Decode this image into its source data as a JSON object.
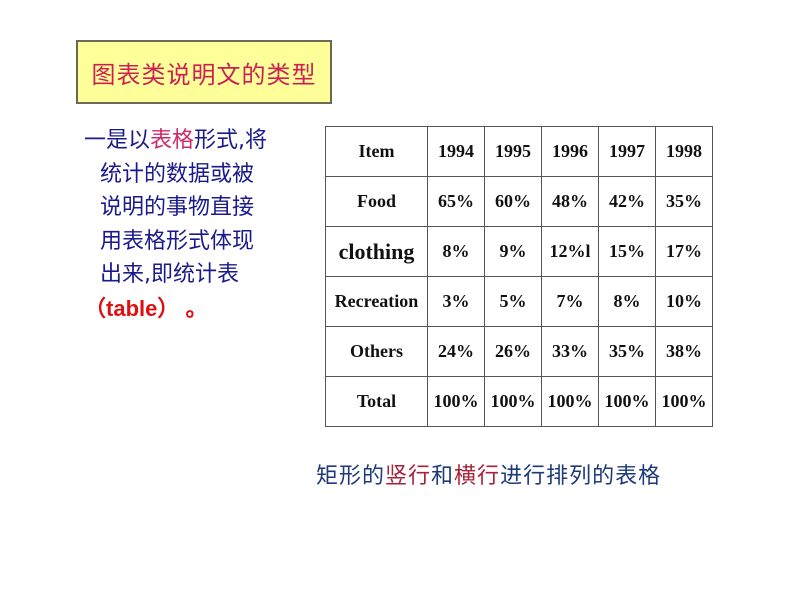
{
  "title": "图表类说明文的类型",
  "left_text": {
    "line1_a": "一是以",
    "line1_hl": "表格",
    "line1_b": "形式,将",
    "line2": "统计的数据或被",
    "line3": "说明的事物直接",
    "line4": "用表格形式体现",
    "line5": "出来,即统计表",
    "line6_open": "（",
    "line6_word": "table",
    "line6_close": "）  。"
  },
  "table": {
    "header": [
      "Item",
      "1994",
      "1995",
      "1996",
      "1997",
      "1998"
    ],
    "rows": [
      [
        "Food",
        "65%",
        "60%",
        "48%",
        "42%",
        "35%"
      ],
      [
        "clothing",
        "8%",
        "9%",
        "12%l",
        "15%",
        "17%"
      ],
      [
        "Recreation",
        "3%",
        "5%",
        "7%",
        "8%",
        "10%"
      ],
      [
        "Others",
        "24%",
        "26%",
        "33%",
        "35%",
        "38%"
      ],
      [
        "Total",
        "100%",
        "100%",
        "100%",
        "100%",
        "100%"
      ]
    ]
  },
  "caption": {
    "part1": "矩形的",
    "part2": "竖行",
    "part3": "和",
    "part4": "横行",
    "part5": "进行排列的表格"
  },
  "colors": {
    "title_bg": "#ffff99",
    "title_text": "#cc1f55",
    "body_text": "#1a1a8c",
    "highlight": "#cc2a6a",
    "table_word": "#dd1111",
    "caption_text": "#1e3a7a",
    "caption_red": "#a8223a"
  }
}
